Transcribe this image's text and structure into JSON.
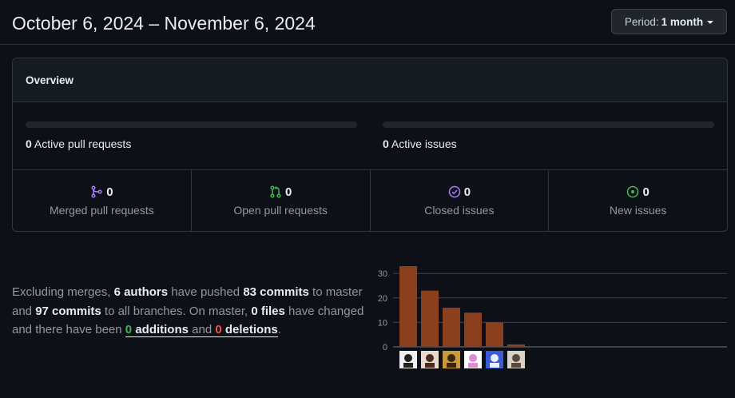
{
  "header": {
    "title": "October 6, 2024 – November 6, 2024",
    "period_prefix": "Period:",
    "period_value": "1 month"
  },
  "overview": {
    "title": "Overview",
    "pull_requests": {
      "count": "0",
      "label": "Active pull requests",
      "progress": 0
    },
    "issues": {
      "count": "0",
      "label": "Active issues",
      "progress": 0
    },
    "stats": [
      {
        "count": "0",
        "label": "Merged pull requests",
        "icon": "git-merge-icon",
        "color": "#ab7df8"
      },
      {
        "count": "0",
        "label": "Open pull requests",
        "icon": "git-pull-request-icon",
        "color": "#3fb950"
      },
      {
        "count": "0",
        "label": "Closed issues",
        "icon": "issue-closed-icon",
        "color": "#ab7df8"
      },
      {
        "count": "0",
        "label": "New issues",
        "icon": "issue-opened-icon",
        "color": "#3fb950"
      }
    ]
  },
  "summary": {
    "t1": "Excluding merges, ",
    "authors": "6 authors",
    "t2": " have pushed ",
    "commits": "83 commits",
    "t3": " to master and ",
    "all_commits": "97 commits",
    "t4": " to all branches. On master, ",
    "files": "0 files",
    "t5": " have changed and there have been ",
    "additions_num": "0",
    "additions_word": "additions",
    "and_word": "and",
    "deletions_num": "0",
    "deletions_word": "deletions",
    "t6": "."
  },
  "chart_data": {
    "type": "bar",
    "categories": [
      "author-1",
      "author-2",
      "author-3",
      "author-4",
      "author-5",
      "author-6"
    ],
    "values": [
      33,
      23,
      16,
      14,
      10,
      1
    ],
    "yticks": [
      0,
      10,
      20,
      30
    ],
    "ylim": [
      0,
      33
    ],
    "bar_color": "#8b3f1f",
    "grid": true
  }
}
